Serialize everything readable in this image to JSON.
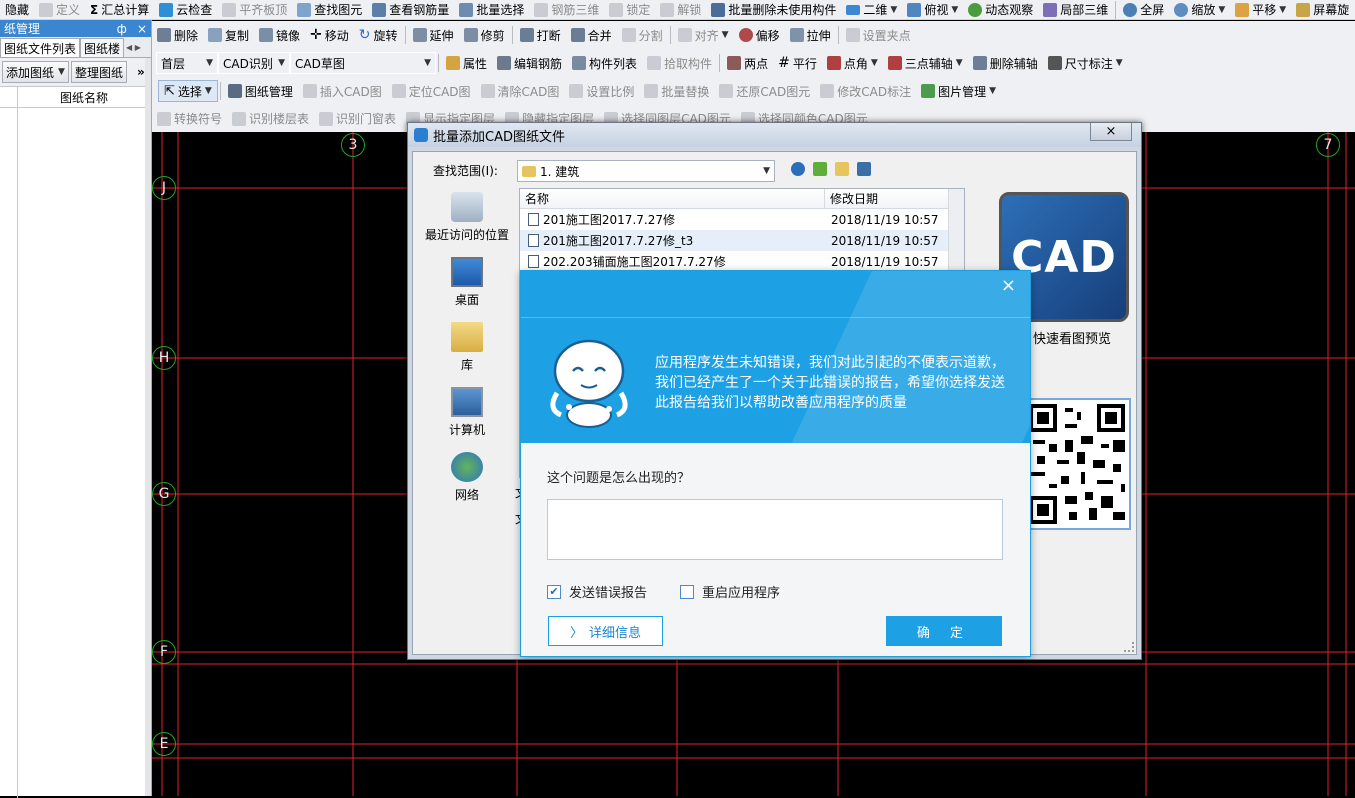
{
  "toolbar1": {
    "items": [
      "隐藏",
      "定义",
      "汇总计算",
      "云检查",
      "平齐板顶",
      "查找图元",
      "查看钢筋量",
      "批量选择",
      "钢筋三维",
      "锁定",
      "解锁",
      "批量删除未使用构件",
      "二维",
      "俯视",
      "动态观察",
      "局部三维",
      "全屏",
      "缩放",
      "平移",
      "屏幕旋"
    ]
  },
  "toolbar2": {
    "items": [
      "删除",
      "复制",
      "镜像",
      "移动",
      "旋转",
      "延伸",
      "修剪",
      "打断",
      "合并",
      "分割",
      "对齐",
      "偏移",
      "拉伸",
      "设置夹点"
    ]
  },
  "toolbar3": {
    "floor": "首层",
    "cad_recognize": "CAD识别",
    "cad_sketch": "CAD草图",
    "items": [
      "属性",
      "编辑钢筋",
      "构件列表",
      "拾取构件",
      "两点",
      "平行",
      "点角",
      "三点辅轴",
      "删除辅轴",
      "尺寸标注"
    ]
  },
  "toolbar4": {
    "items": [
      "选择",
      "图纸管理",
      "插入CAD图",
      "定位CAD图",
      "清除CAD图",
      "设置比例",
      "批量替换",
      "还原CAD图元",
      "修改CAD标注",
      "图片管理"
    ]
  },
  "toolbar5": {
    "items": [
      "转换符号",
      "识别楼层表",
      "识别门窗表",
      "显示指定图层",
      "隐藏指定图层",
      "选择同图层CAD图元",
      "选择同颜色CAD图元"
    ]
  },
  "left_panel": {
    "title": "纸管理",
    "pin": "ф",
    "close": "×",
    "tab1": "图纸文件列表",
    "tab2": "图纸楼",
    "add_btn": "添加图纸",
    "arrange_btn": "整理图纸",
    "more": "»",
    "col_name": "图纸名称"
  },
  "axes": {
    "top": [
      "3",
      "7"
    ],
    "left": [
      "J",
      "H",
      "G",
      "F",
      "E"
    ]
  },
  "file_dialog": {
    "title": "批量添加CAD图纸文件",
    "close": "×",
    "look_in_label": "查找范围(I):",
    "look_in_value": "1. 建筑",
    "places": [
      "最近访问的位置",
      "桌面",
      "库",
      "计算机",
      "网络"
    ],
    "col_name": "名称",
    "col_date": "修改日期",
    "files": [
      {
        "name": "201施工图2017.7.27修",
        "date": "2018/11/19 10:57"
      },
      {
        "name": "201施工图2017.7.27修_t3",
        "date": "2018/11/19 10:57"
      },
      {
        "name": "202.203铺面施工图2017.7.27修",
        "date": "2018/11/19 10:57"
      }
    ],
    "preview_logo": "CAD",
    "preview_caption": "快速看图预览",
    "hidden_label_1": "文",
    "hidden_label_2": "文"
  },
  "error_dialog": {
    "close": "×",
    "message": "应用程序发生未知错误，我们对此引起的不便表示道歉，我们已经产生了一个关于此错误的报告，希望你选择发送此报告给我们以帮助改善应用程序的质量",
    "question": "这个问题是怎么出现的？",
    "send_report": "发送错误报告",
    "send_report_checked": true,
    "restart_app": "重启应用程序",
    "restart_app_checked": false,
    "detail_btn": "详细信息",
    "ok_btn": "确 定"
  },
  "colors": {
    "accent": "#1ea1e4",
    "grid": "#e0222a",
    "axis_circle": "#1fa61f"
  }
}
